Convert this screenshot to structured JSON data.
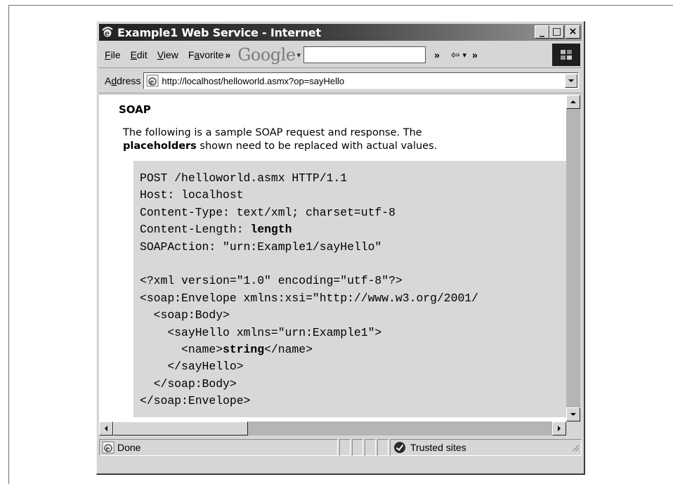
{
  "window": {
    "title": "Example1 Web Service - Internet",
    "controls": {
      "minimize": "_",
      "maximize": "□",
      "close": "×"
    }
  },
  "menu": {
    "items": [
      {
        "label": "File",
        "accel": "F",
        "rest": "ile"
      },
      {
        "label": "Edit",
        "accel": "E",
        "rest": "dit"
      },
      {
        "label": "View",
        "accel": "V",
        "rest": "iew"
      },
      {
        "label": "Favorite",
        "pre": "F",
        "accel": "a",
        "rest": "vorite"
      }
    ],
    "overflow_chevron": "»",
    "google_logo": "Google",
    "google_dropdown": "▾",
    "google_search_value": "",
    "back_arrow": "⇦",
    "back_dropdown": "▾"
  },
  "address": {
    "label_pre": "A",
    "label_accel": "d",
    "label_rest": "dress",
    "url": "http://localhost/helloworld.asmx?op=sayHello"
  },
  "content": {
    "section_title": "SOAP",
    "description_line1": "The following is a sample SOAP request and response. The",
    "description_bold": "placeholders",
    "description_line2_rest": " shown need to be replaced with actual values.",
    "code": {
      "line1": "POST /helloworld.asmx HTTP/1.1",
      "line2": "Host: localhost",
      "line3": "Content-Type: text/xml; charset=utf-8",
      "line4_pre": "Content-Length: ",
      "line4_bold": "length",
      "line5": "SOAPAction: \"urn:Example1/sayHello\"",
      "line7": "<?xml version=\"1.0\" encoding=\"utf-8\"?>",
      "line8": "<soap:Envelope xmlns:xsi=\"http://www.w3.org/2001/",
      "line9": "  <soap:Body>",
      "line10": "    <sayHello xmlns=\"urn:Example1\">",
      "line11_pre": "      <name>",
      "line11_bold": "string",
      "line11_post": "</name>",
      "line12": "    </sayHello>",
      "line13": "  </soap:Body>",
      "line14": "</soap:Envelope>"
    }
  },
  "status": {
    "text": "Done",
    "zone": "Trusted sites"
  }
}
